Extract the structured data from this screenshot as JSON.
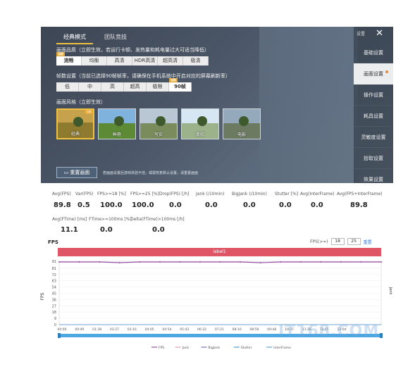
{
  "game": {
    "tabs": [
      "经典模式",
      "团队竞技"
    ],
    "quality": {
      "title": "画面品质（立即生效，若运行卡顿、发热量和耗电量过大可适当降低）",
      "options": [
        "流畅",
        "均衡",
        "高清",
        "HDR高清",
        "超高清",
        "极清"
      ],
      "selected": 0,
      "tag": "当前"
    },
    "fps": {
      "title": "帧数设置（当前已选择90帧帧率，请确保在手机系统中开启对应的屏幕刷新率）",
      "options": [
        "低",
        "中",
        "高",
        "超高",
        "极限",
        "90帧"
      ],
      "selected": 5,
      "tag": "当前"
    },
    "style": {
      "title": "画面风格（立即生效）",
      "options": [
        "经典",
        "鲜艳",
        "写实",
        "柔和",
        "电影"
      ],
      "selected": 0,
      "tag": "当前"
    },
    "reset_label": "重置画面",
    "reset_note": "若画面设置后游戏体验不佳，或需恢复默认设置，请重置画面",
    "side_top": "设置",
    "side_items": [
      "基础设置",
      "画面设置",
      "操作设置",
      "耗具设置",
      "灵敏度设置",
      "拾取设置",
      "效果设置"
    ],
    "side_active": 1
  },
  "stats_row1": {
    "headers": [
      "Avg(FPS)",
      "Var(FPS)",
      "FPS>=18 [%]",
      "FPS>=25 [%]",
      "Drop(FPS) [/h]",
      "Jank (/10min)",
      "BigJank (/10min)",
      "Stutter [%]",
      "Avg(InterFrame)",
      "Avg(FPS+InterFrame)"
    ],
    "values": [
      "89.8",
      "0.5",
      "100.0",
      "100.0",
      "0.0",
      "0.0",
      "0.0",
      "0.0",
      "0.0",
      "89.8"
    ]
  },
  "stats_row2": {
    "headers": [
      "Avg(FTime) [ms]",
      "FTime>=100ms [%]",
      "Delta(FTime)>100ms [/h]"
    ],
    "values": [
      "11.1",
      "0.0",
      "0.0"
    ]
  },
  "chart": {
    "title": "FPS",
    "fps_filter_label": "FPS(>=)",
    "fps_filter_values": [
      "18",
      "25"
    ],
    "reset_link": "重置",
    "label_bar": "label1",
    "y_label": "FPS",
    "y_right_label": "Jank",
    "y_ticks": [
      0,
      9,
      18,
      27,
      36,
      45,
      54,
      63,
      72,
      81,
      91
    ],
    "x_ticks": [
      "00:00",
      "00:49",
      "01:38",
      "02:27",
      "03:16",
      "04:05",
      "04:54",
      "05:43",
      "06:32",
      "07:21",
      "08:10",
      "08:59",
      "09:48",
      "10:37",
      "11:26",
      "12:15",
      "13:04"
    ],
    "legend": [
      "FPS",
      "Jank",
      "BigJank",
      "Stutter",
      "InterFrame"
    ],
    "colors": {
      "fps": "#9b4fa8",
      "jank": "#e8a0b4",
      "bigjank": "#7a6fc0",
      "stutter": "#4aa0d8",
      "interframe": "#60a8d8",
      "scroll": "#4da7e0"
    }
  },
  "chart_data": {
    "type": "line",
    "title": "FPS",
    "xlabel": "",
    "ylabel": "FPS",
    "ylim": [
      0,
      91
    ],
    "x": [
      "00:00",
      "00:49",
      "01:38",
      "02:27",
      "03:16",
      "04:05",
      "04:54",
      "05:43",
      "06:32",
      "07:21",
      "08:10",
      "08:59",
      "09:48",
      "10:37",
      "11:26",
      "12:15",
      "13:04"
    ],
    "series": [
      {
        "name": "FPS",
        "values": [
          90,
          90,
          90,
          89,
          90,
          90,
          90,
          90,
          90,
          90,
          89,
          90,
          90,
          90,
          90,
          90,
          90
        ]
      },
      {
        "name": "Jank",
        "values": [
          0,
          0,
          0,
          0,
          0,
          0,
          0,
          0,
          0,
          0,
          0,
          0,
          0,
          0,
          0,
          0,
          0
        ]
      },
      {
        "name": "BigJank",
        "values": [
          0,
          0,
          0,
          0,
          0,
          0,
          0,
          0,
          0,
          0,
          0,
          0,
          0,
          0,
          0,
          0,
          0
        ]
      },
      {
        "name": "Stutter",
        "values": [
          0,
          0,
          0,
          0,
          0,
          0,
          0,
          0,
          0,
          0,
          0,
          0,
          0,
          0,
          0,
          0,
          0
        ]
      },
      {
        "name": "InterFrame",
        "values": [
          0,
          0,
          0,
          0,
          0,
          0,
          0,
          0,
          0,
          0,
          0,
          0,
          0,
          0,
          0,
          0,
          0
        ]
      }
    ]
  },
  "watermark": "IT168.COM"
}
